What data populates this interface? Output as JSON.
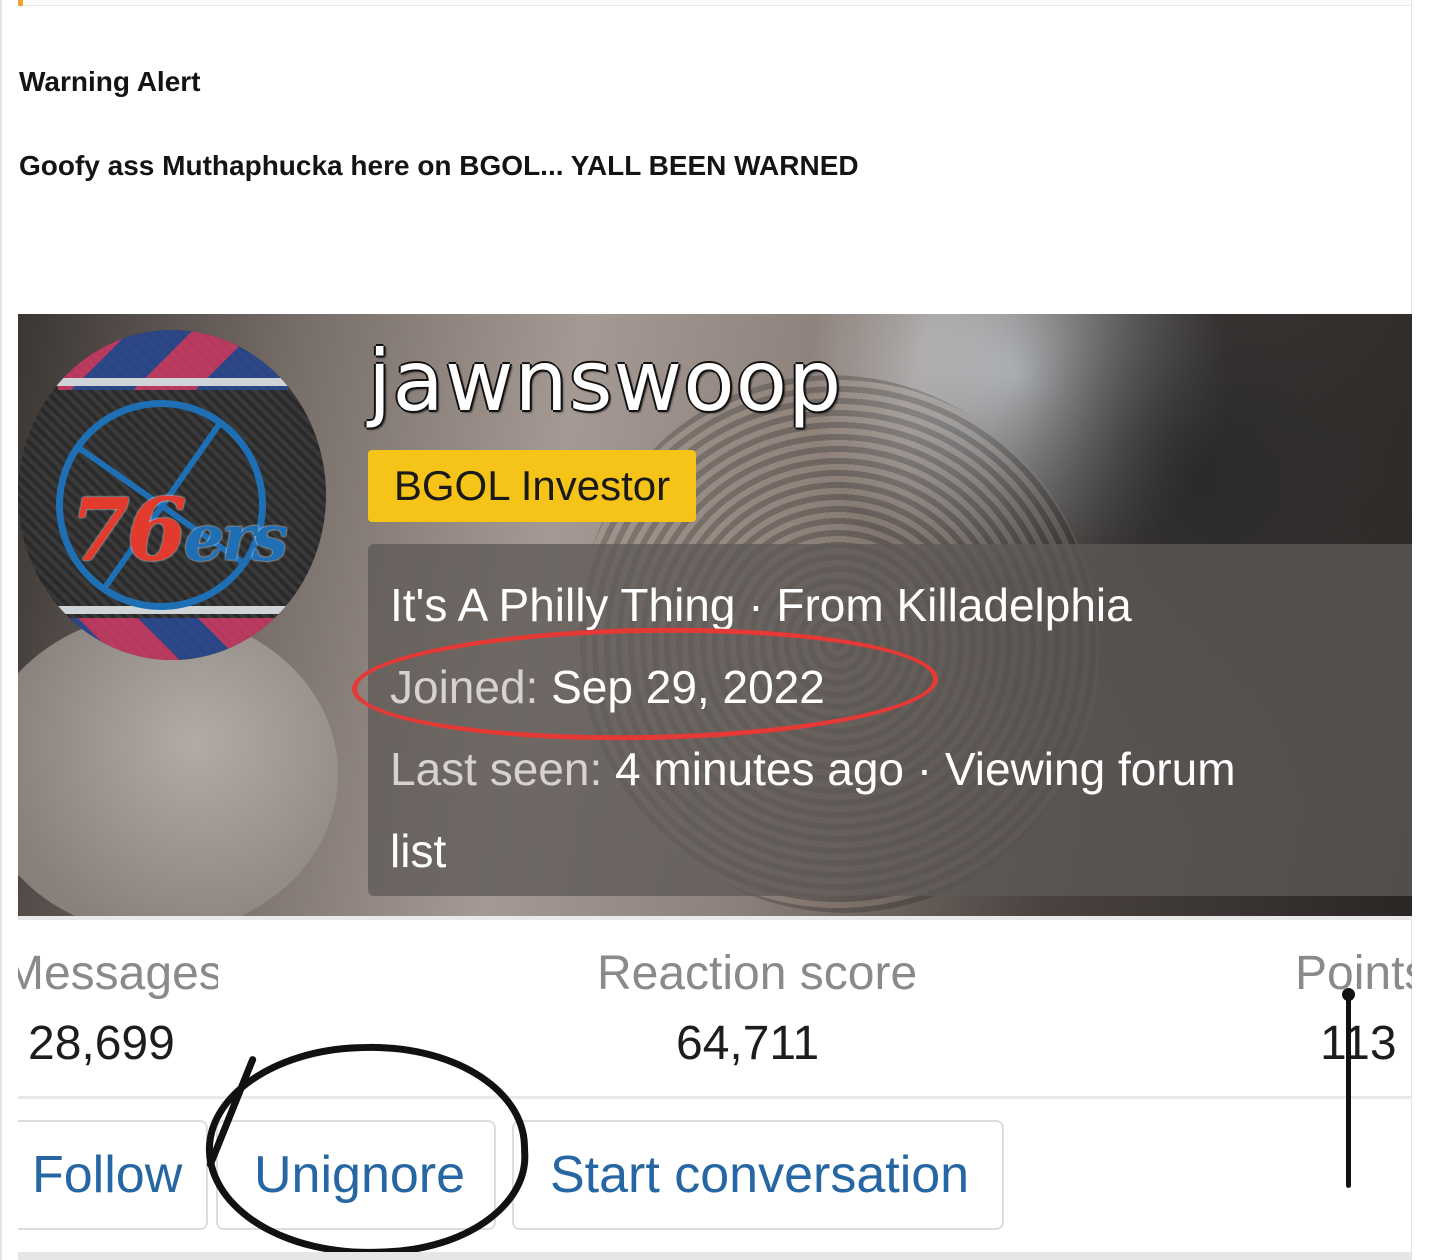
{
  "post": {
    "title": "Warning Alert",
    "body": "Goofy ass Muthaphucka here on BGOL... YALL BEEN WARNED"
  },
  "profile": {
    "username": "jawnswoop",
    "rank": "BGOL Investor",
    "custom_title": "It's A Philly Thing",
    "location": "From Killadelphia",
    "joined_label": "Joined:",
    "joined_value": "Sep 29, 2022",
    "last_seen_label": "Last seen:",
    "last_seen_value": "4 minutes ago",
    "activity": "Viewing forum list",
    "avatar_text_num": "76",
    "avatar_text_suffix": "ers"
  },
  "stats": {
    "messages_label": "Messages",
    "messages_value": "28,699",
    "reaction_label": "Reaction score",
    "reaction_value": "64,711",
    "points_label": "Points",
    "points_value": "113"
  },
  "actions": {
    "follow": "Follow",
    "unignore": "Unignore",
    "start_conversation": "Start conversation"
  },
  "colors": {
    "accent_link": "#2666a3",
    "rank_badge": "#f6c318",
    "annotation_red": "#e53935",
    "quote_accent": "#f0a52a"
  }
}
